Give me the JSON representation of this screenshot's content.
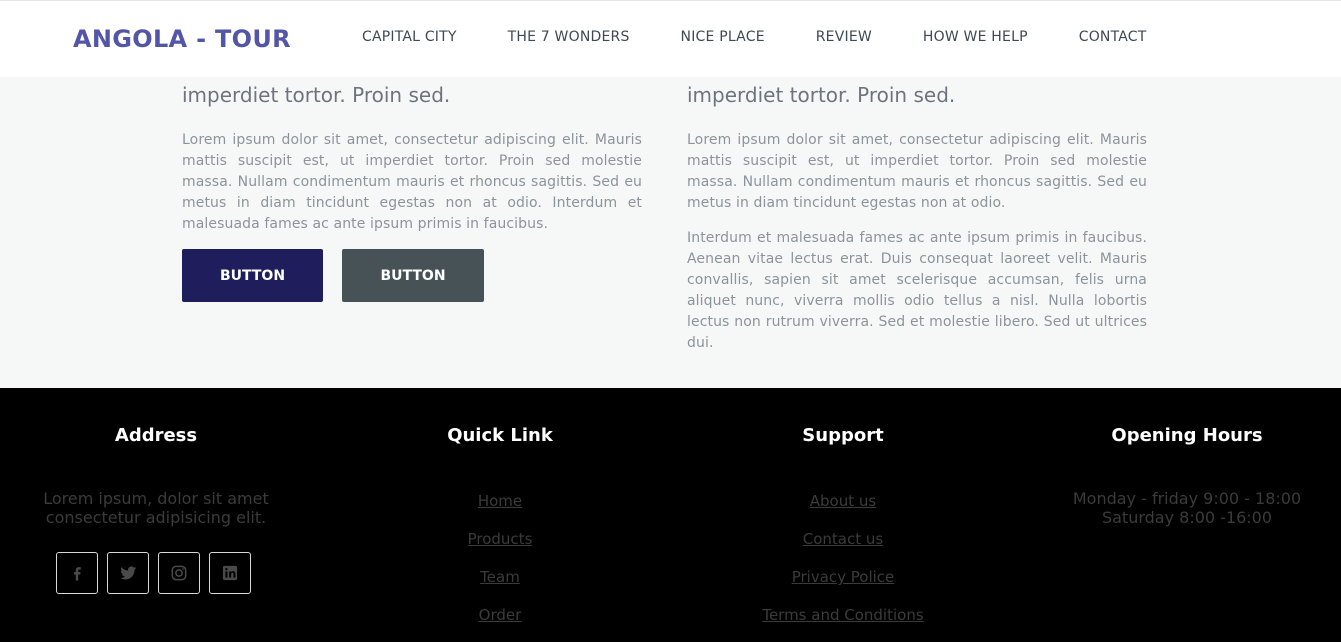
{
  "header": {
    "brand": "ANGOLA - TOUR",
    "nav": [
      "CAPITAL CITY",
      "THE 7 WONDERS",
      "NICE PLACE",
      "REVIEW",
      "HOW WE HELP",
      "CONTACT"
    ]
  },
  "main": {
    "left": {
      "subtitle": "imperdiet tortor. Proin sed.",
      "paragraph": "Lorem ipsum dolor sit amet, consectetur adipiscing elit. Mauris mattis suscipit est, ut imperdiet tortor. Proin sed molestie massa. Nullam condimentum mauris et rhoncus sagittis. Sed eu metus in diam tincidunt egestas non at odio. Interdum et malesuada fames ac ante ipsum primis in faucibus.",
      "button_primary": "BUTTON",
      "button_secondary": "BUTTON"
    },
    "right": {
      "subtitle": "imperdiet tortor. Proin sed.",
      "paragraph1": "Lorem ipsum dolor sit amet, consectetur adipiscing elit. Mauris mattis suscipit est, ut imperdiet tortor. Proin sed molestie massa. Nullam condimentum mauris et rhoncus sagittis. Sed eu metus in diam tincidunt egestas non at odio.",
      "paragraph2": "Interdum et malesuada fames ac ante ipsum primis in faucibus. Aenean vitae lectus erat. Duis consequat laoreet velit. Mauris convallis, sapien sit amet scelerisque accumsan, felis urna aliquet nunc, viverra mollis odio tellus a nisl. Nulla lobortis lectus non rutrum viverra. Sed et molestie libero. Sed ut ultrices dui."
    }
  },
  "footer": {
    "address": {
      "title": "Address",
      "text": "Lorem ipsum, dolor sit amet consectetur adipisicing elit.",
      "socials": [
        "facebook-icon",
        "twitter-icon",
        "instagram-icon",
        "linkedin-icon"
      ]
    },
    "quick_link": {
      "title": "Quick Link",
      "links": [
        "Home",
        "Products",
        "Team",
        "Order"
      ]
    },
    "support": {
      "title": "Support",
      "links": [
        "About us",
        "Contact us",
        "Privacy Police",
        "Terms and Conditions"
      ]
    },
    "opening_hours": {
      "title": "Opening Hours",
      "line1": "Monday - friday 9:00 - 18:00",
      "line2": "Saturday 8:00 -16:00"
    }
  },
  "colors": {
    "brand": "#5356a6",
    "primary_button": "#1f1d5c",
    "secondary_button": "#475256",
    "footer_bg": "#000000"
  }
}
